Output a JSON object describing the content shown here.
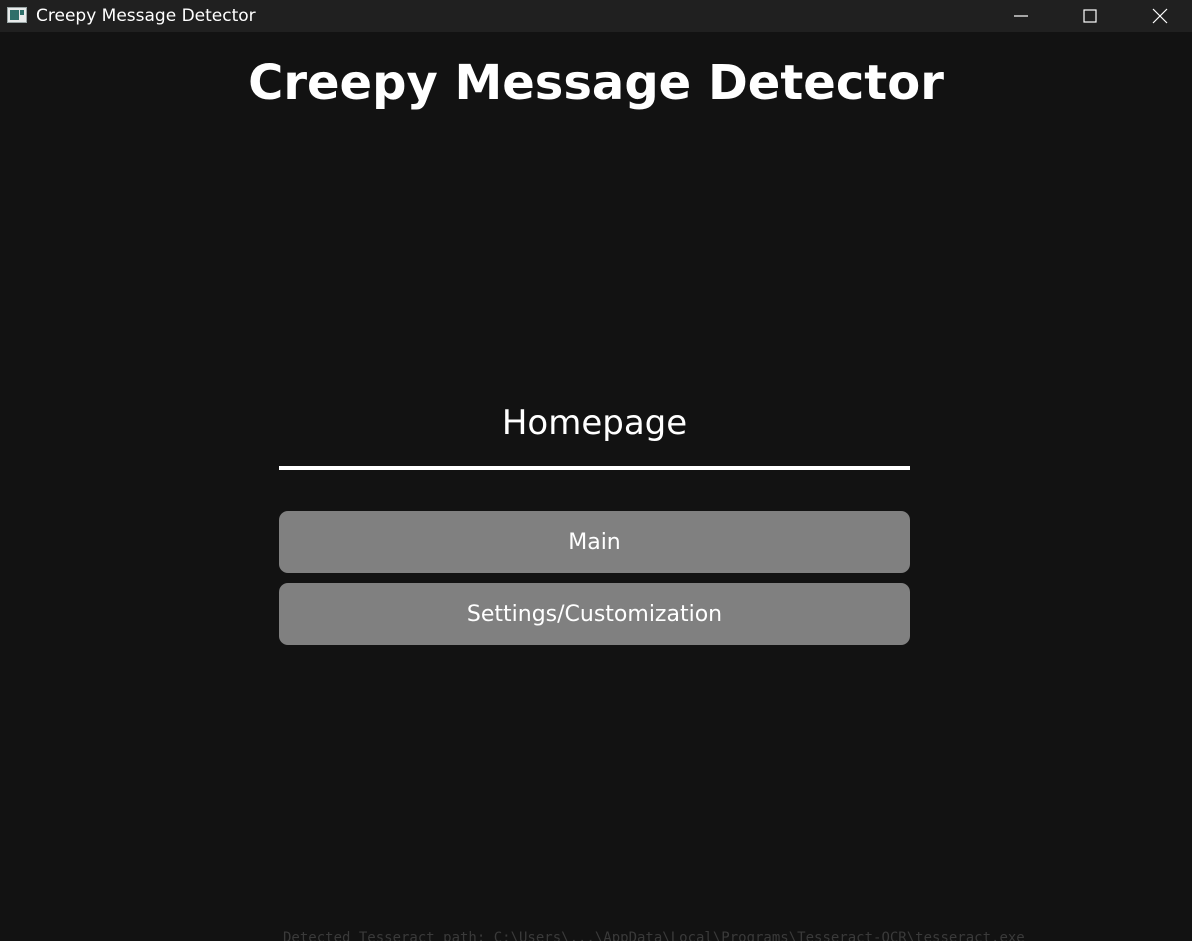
{
  "window": {
    "title": "Creepy Message Detector",
    "app_icon": "app-window-icon",
    "controls": {
      "minimize_icon": "minimize-icon",
      "maximize_icon": "maximize-icon",
      "close_icon": "close-icon"
    }
  },
  "page": {
    "heading": "Creepy Message Detector",
    "section_label": "Homepage",
    "buttons": {
      "main_label": "Main",
      "settings_label": "Settings/Customization"
    }
  },
  "background_text": "Detected Tesseract path: C:\\Users\\...\\AppData\\Local\\Programs\\Tesseract-OCR\\tesseract.exe",
  "colors": {
    "background": "#121212",
    "titlebar": "#202020",
    "button": "#808080",
    "text": "#ffffff"
  }
}
